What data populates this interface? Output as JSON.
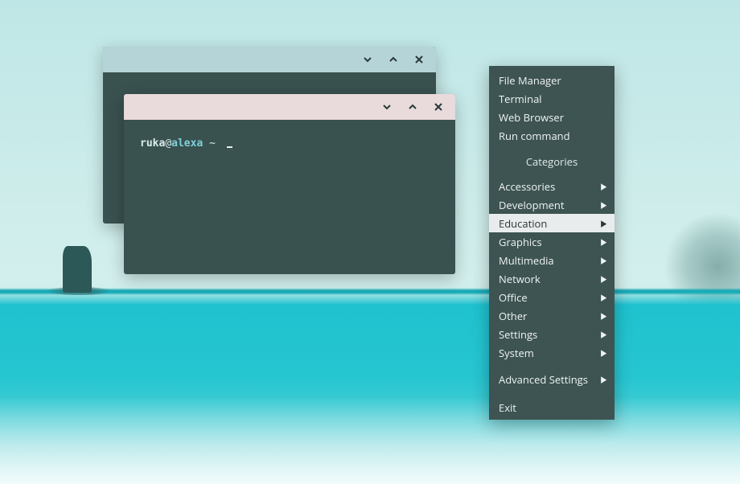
{
  "colors": {
    "window_bg": "#39514f",
    "titlebar_inactive": "#b5d4d8",
    "titlebar_active": "#e9dadb",
    "menu_bg": "#3e5452",
    "menu_highlight": "#e9ecec"
  },
  "terminal": {
    "prompt_user": "ruka",
    "prompt_at": "@",
    "prompt_host": "alexa",
    "prompt_tail": " ~ "
  },
  "menu": {
    "launchers": [
      "File Manager",
      "Terminal",
      "Web Browser",
      "Run command"
    ],
    "categories_title": "Categories",
    "categories": [
      {
        "label": "Accessories",
        "hovered": false
      },
      {
        "label": "Development",
        "hovered": false
      },
      {
        "label": "Education",
        "hovered": true
      },
      {
        "label": "Graphics",
        "hovered": false
      },
      {
        "label": "Multimedia",
        "hovered": false
      },
      {
        "label": "Network",
        "hovered": false
      },
      {
        "label": "Office",
        "hovered": false
      },
      {
        "label": "Other",
        "hovered": false
      },
      {
        "label": "Settings",
        "hovered": false
      },
      {
        "label": "System",
        "hovered": false
      }
    ],
    "advanced_label": "Advanced Settings",
    "exit_label": "Exit"
  }
}
